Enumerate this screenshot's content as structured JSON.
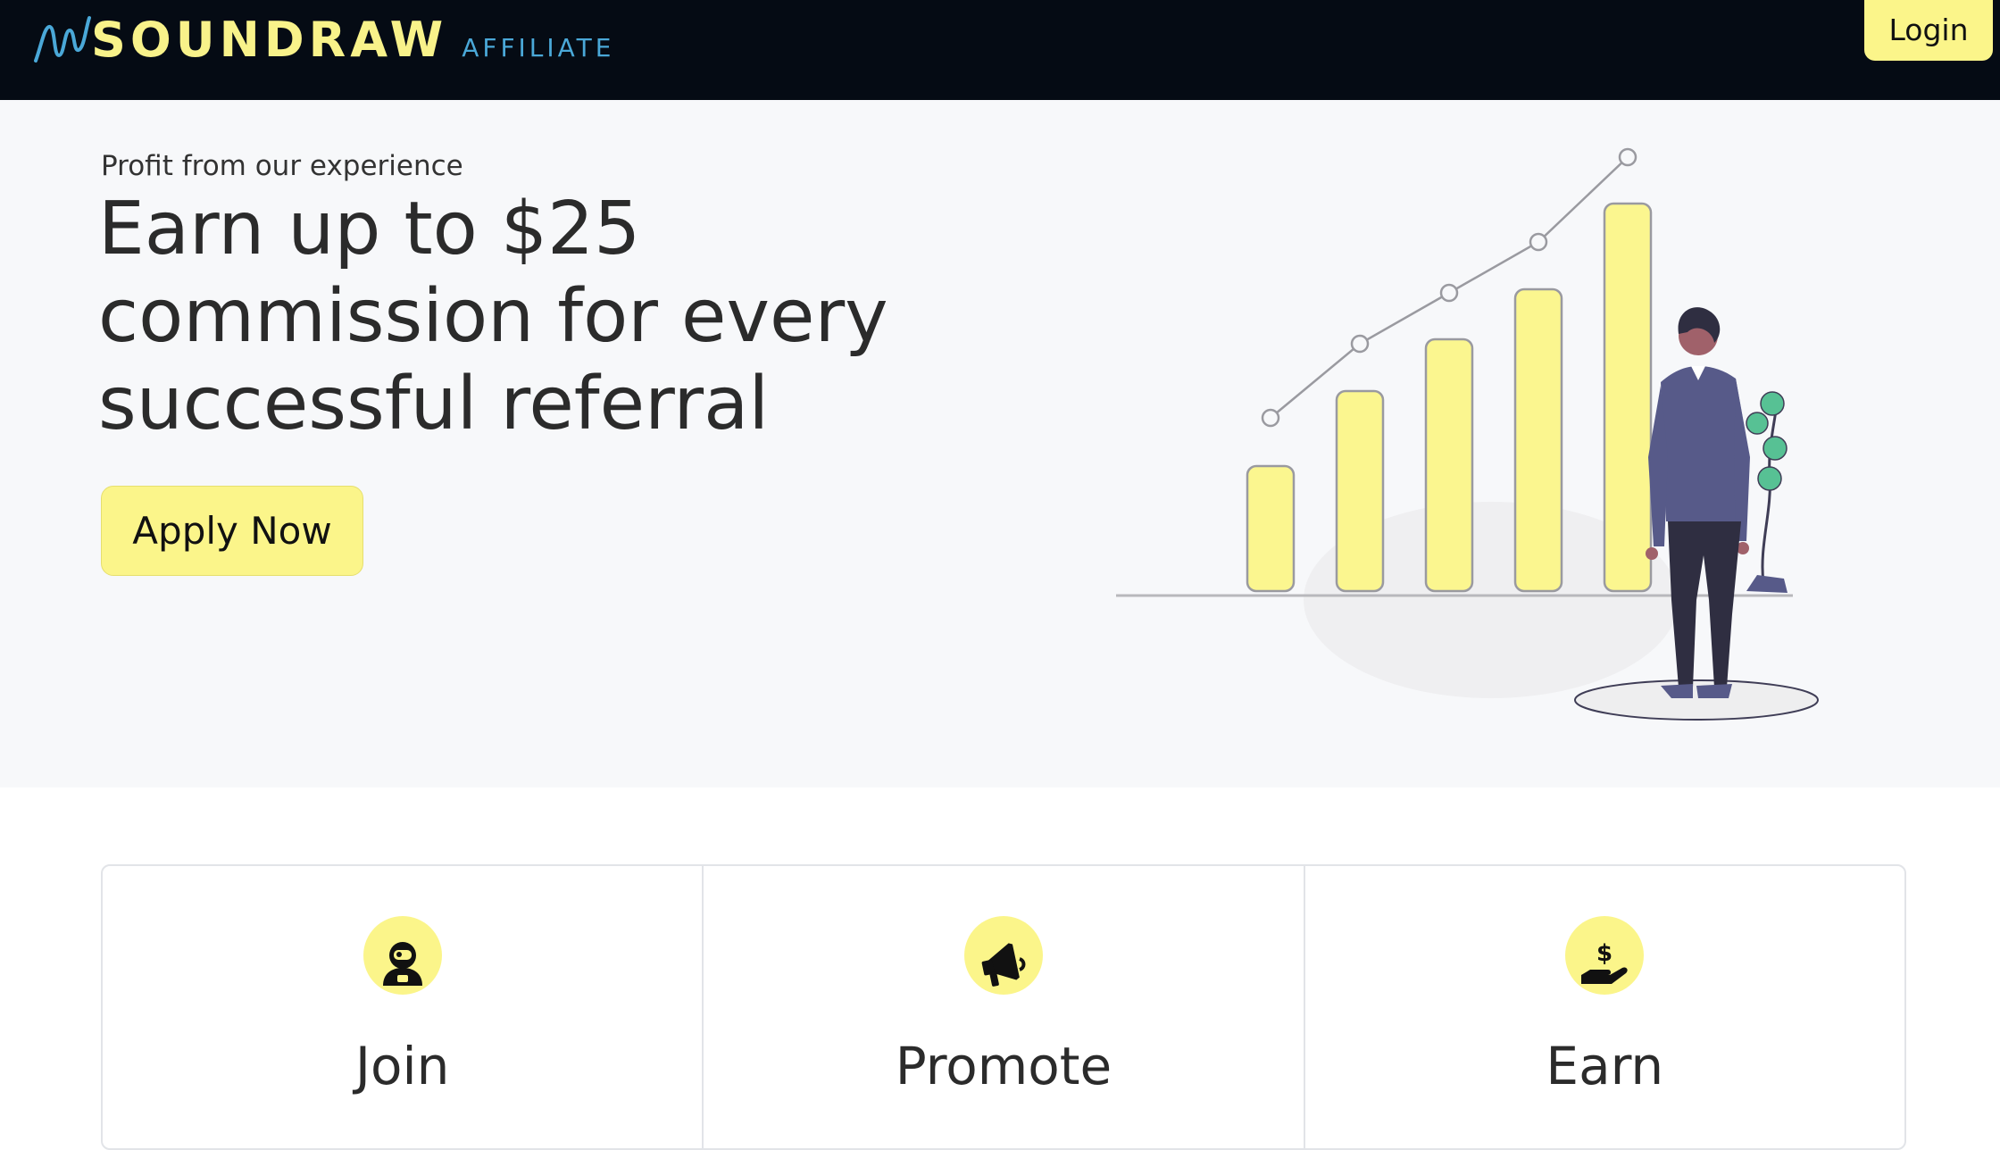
{
  "header": {
    "brand": "SOUNDRAW",
    "brand_sub": "AFFILIATE",
    "login_label": "Login"
  },
  "hero": {
    "eyebrow": "Profit from our experience",
    "headline": "Earn up to $25 commission for every successful referral",
    "cta_label": "Apply Now"
  },
  "steps": [
    {
      "title": "Join",
      "icon": "user-astronaut-icon"
    },
    {
      "title": "Promote",
      "icon": "megaphone-icon"
    },
    {
      "title": "Earn",
      "icon": "hand-dollar-icon"
    }
  ],
  "colors": {
    "header_bg": "#050b14",
    "brand_yellow": "#f8f28a",
    "accent_yellow": "#fbf58a",
    "brand_blue": "#4aa8d8",
    "hero_bg": "#f7f8fa",
    "suit": "#575a89"
  }
}
